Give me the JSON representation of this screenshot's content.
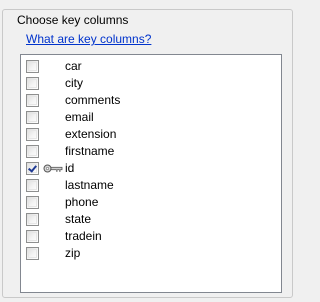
{
  "groupbox": {
    "title": "Choose key columns",
    "help_link": "What are key columns?"
  },
  "columns": [
    {
      "name": "car",
      "checked": false,
      "key": false
    },
    {
      "name": "city",
      "checked": false,
      "key": false
    },
    {
      "name": "comments",
      "checked": false,
      "key": false
    },
    {
      "name": "email",
      "checked": false,
      "key": false
    },
    {
      "name": "extension",
      "checked": false,
      "key": false
    },
    {
      "name": "firstname",
      "checked": false,
      "key": false
    },
    {
      "name": "id",
      "checked": true,
      "key": true
    },
    {
      "name": "lastname",
      "checked": false,
      "key": false
    },
    {
      "name": "phone",
      "checked": false,
      "key": false
    },
    {
      "name": "state",
      "checked": false,
      "key": false
    },
    {
      "name": "tradein",
      "checked": false,
      "key": false
    },
    {
      "name": "zip",
      "checked": false,
      "key": false
    }
  ],
  "icons": {
    "key": "key-icon"
  }
}
